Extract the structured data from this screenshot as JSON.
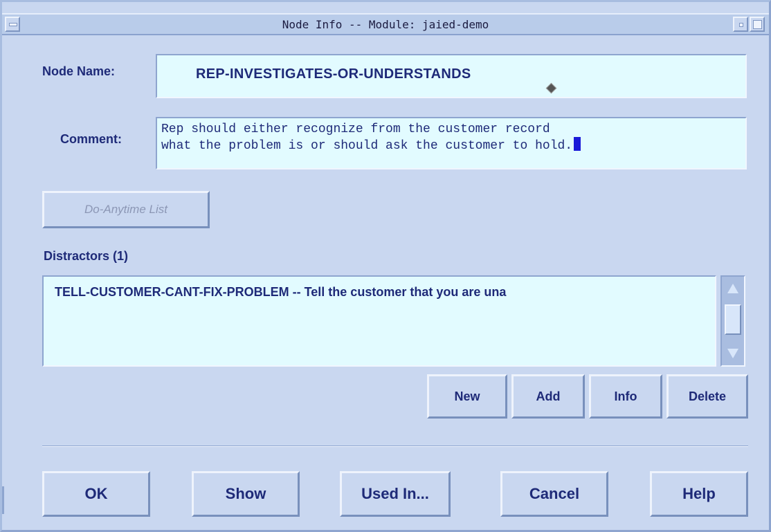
{
  "window": {
    "title": "Node Info -- Module: jaied-demo"
  },
  "node_name": {
    "label": "Node Name:",
    "value": "REP-INVESTIGATES-OR-UNDERSTANDS"
  },
  "comment": {
    "label": "Comment:",
    "lines": [
      "Rep should either recognize from the customer record",
      "what the problem is or should ask the customer to hold."
    ]
  },
  "do_anytime_button": "Do-Anytime List",
  "distractors": {
    "label": "Distractors (1)",
    "items": [
      "TELL-CUSTOMER-CANT-FIX-PROBLEM -- Tell the customer that you are una"
    ],
    "buttons": {
      "new": "New",
      "add": "Add",
      "info": "Info",
      "delete": "Delete"
    }
  },
  "footer_buttons": {
    "ok": "OK",
    "show": "Show",
    "used_in": "Used In...",
    "cancel": "Cancel",
    "help": "Help"
  },
  "colors": {
    "background": "#c9d7f0",
    "field": "#e2fbff",
    "text": "#1e2a78",
    "cursor": "#1a1ad8"
  },
  "icons": [
    "window-menu-icon",
    "minimize-icon",
    "maximize-icon",
    "scroll-up-icon",
    "scroll-down-icon",
    "pointer-diamond-icon"
  ]
}
